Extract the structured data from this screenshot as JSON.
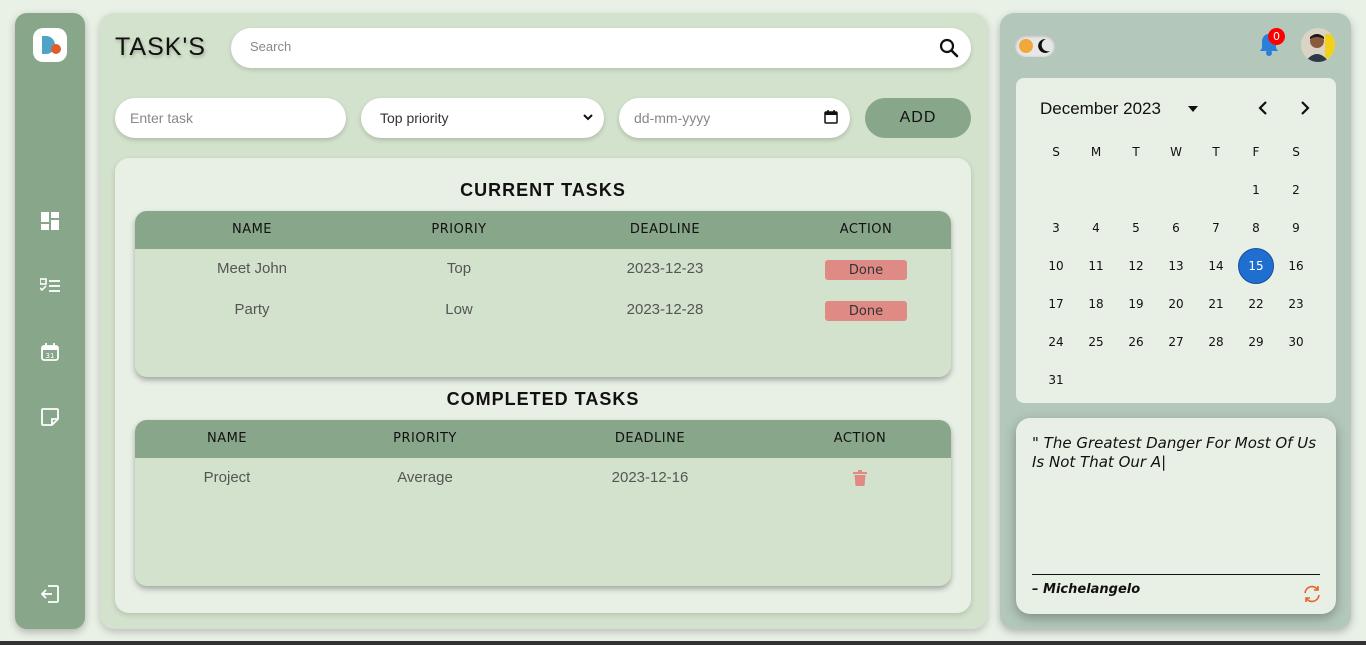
{
  "header": {
    "title": "TASK'S"
  },
  "search": {
    "placeholder": "Search"
  },
  "form": {
    "task_placeholder": "Enter task",
    "priority_selected": "Top priority",
    "date_placeholder": "dd-mm-yyyy",
    "add_label": "ADD"
  },
  "current": {
    "title": "CURRENT TASKS",
    "columns": [
      "NAME",
      "PRIORIY",
      "DEADLINE",
      "ACTION"
    ],
    "rows": [
      {
        "name": "Meet John",
        "priority": "Top",
        "deadline": "2023-12-23",
        "action": "Done"
      },
      {
        "name": "Party",
        "priority": "Low",
        "deadline": "2023-12-28",
        "action": "Done"
      }
    ]
  },
  "completed": {
    "title": "COMPLETED TASKS",
    "columns": [
      "NAME",
      "PRIORITY",
      "DEADLINE",
      "ACTION"
    ],
    "rows": [
      {
        "name": "Project",
        "priority": "Average",
        "deadline": "2023-12-16",
        "action_icon": "trash-icon"
      }
    ]
  },
  "sidebar": {
    "icons": [
      "dashboard-icon",
      "checklist-icon",
      "calendar-icon",
      "note-icon",
      "logout-icon"
    ]
  },
  "notifications": {
    "count": "0"
  },
  "calendar": {
    "month_label": "December 2023",
    "weekdays": [
      "S",
      "M",
      "T",
      "W",
      "T",
      "F",
      "S"
    ],
    "first_weekday": 5,
    "days_in_month": 31,
    "selected_day": 15
  },
  "quote": {
    "text": "\" The Greatest Danger For Most Of Us Is Not That Our A|",
    "author": "– Michelangelo"
  },
  "colors": {
    "accent": "#88a68a",
    "panel": "#d3e2cc",
    "done": "#e08a86",
    "today": "#1f6fd1",
    "badge": "#ff0000"
  }
}
